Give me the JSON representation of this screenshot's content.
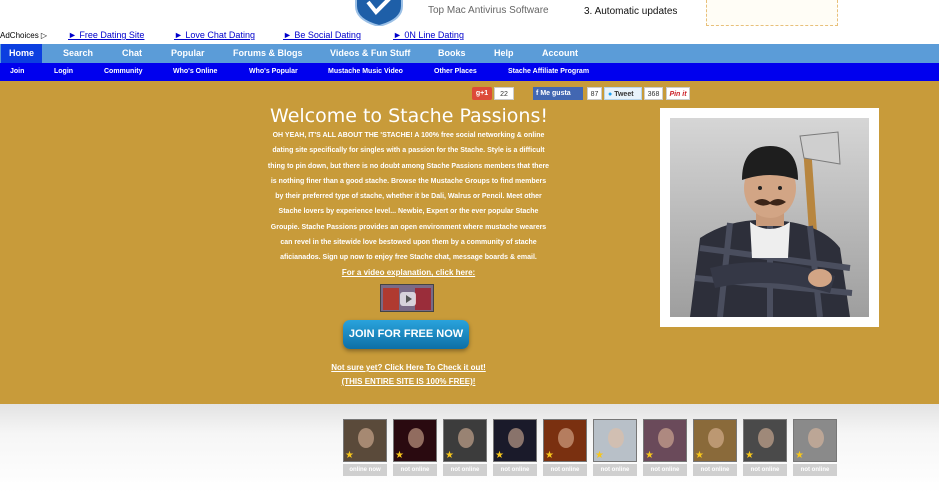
{
  "ad": {
    "text1": "Top Mac Antivirus Software",
    "text2": "3. Automatic updates",
    "adchoices": "AdChoices ▷",
    "links": [
      "► Free Dating Site",
      "► Love Chat Dating",
      "► Be Social Dating",
      "► 0N Line Dating"
    ]
  },
  "nav": {
    "primary": [
      "Home",
      "Search",
      "Chat",
      "Popular",
      "Forums & Blogs",
      "Videos & Fun Stuff",
      "Books",
      "Help",
      "Account"
    ],
    "secondary": [
      "Join",
      "Login",
      "Community",
      "Who's Online",
      "Who's Popular",
      "Mustache Music Video",
      "Other Places",
      "Stache Affiliate Program"
    ]
  },
  "social": {
    "gplus": "g+1",
    "gplus_count": "22",
    "fb": "Me gusta",
    "fb_count": "87",
    "tweet": "Tweet",
    "tweet_count": "368",
    "pin": "Pin it"
  },
  "hero": {
    "title": "Welcome to Stache Passions!",
    "intro": "OH YEAH, IT'S ALL ABOUT THE 'STACHE! A 100% free social networking & online dating site specifically for singles with a passion for the Stache. Style is a difficult thing to pin down, but there is no doubt among Stache Passions members that there is nothing finer than a good stache. Browse the Mustache Groups to find members by their preferred type of stache, whether it be Dali, Walrus or Pencil. Meet other Stache lovers by experience level... Newbie, Expert or the ever popular Stache Groupie. Stache Passions provides an open environment where mustache wearers can revel in the sitewide love bestowed upon them by a community of stache aficianados. Sign up now to enjoy free Stache chat, message boards & email.",
    "video_link": "For a video explanation, click here:",
    "join_button": "JOIN FOR FREE NOW",
    "check_link": "Not sure yet? Click Here To Check it out!",
    "free_link": "(THIS ENTIRE SITE IS 100% FREE)!"
  },
  "members": [
    {
      "status": "online now",
      "color": "#5a4a3a"
    },
    {
      "status": "not online",
      "color": "#2a0a10"
    },
    {
      "status": "not online",
      "color": "#3c3c3c"
    },
    {
      "status": "not online",
      "color": "#1a1a2a"
    },
    {
      "status": "not online",
      "color": "#7a3010"
    },
    {
      "status": "not online",
      "color": "#b8c0c8"
    },
    {
      "status": "not online",
      "color": "#6a4a5a"
    },
    {
      "status": "not online",
      "color": "#8a6a3a"
    },
    {
      "status": "not online",
      "color": "#4a4a4a"
    },
    {
      "status": "not online",
      "color": "#8a8a8a"
    }
  ],
  "colors": {
    "hero_bg": "#c89b3a",
    "nav_primary": "#5b9cd8",
    "nav_secondary": "#0000ee",
    "join_button": "#1a8ac4"
  }
}
